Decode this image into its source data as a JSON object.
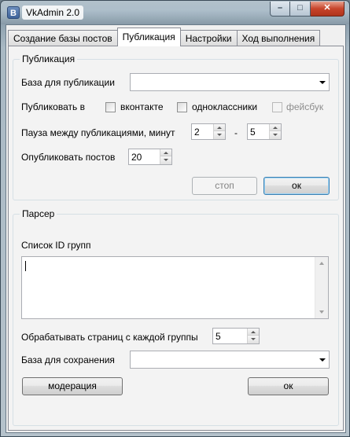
{
  "window": {
    "app_icon_letter": "B",
    "title": "VkAdmin 2.0",
    "min_glyph": "–",
    "max_glyph": "□",
    "close_glyph": "✕"
  },
  "tabs": [
    {
      "label": "Создание базы постов",
      "active": false
    },
    {
      "label": "Публикация",
      "active": true
    },
    {
      "label": "Настройки",
      "active": false
    },
    {
      "label": "Ход выполнения",
      "active": false
    }
  ],
  "publication": {
    "group_title": "Публикация",
    "base_label": "База для публикации",
    "base_value": "",
    "publish_in_label": "Публиковать в",
    "targets": [
      {
        "label": "вконтакте",
        "checked": false,
        "enabled": true
      },
      {
        "label": "одноклассники",
        "checked": false,
        "enabled": true
      },
      {
        "label": "фейсбук",
        "checked": false,
        "enabled": false
      }
    ],
    "pause_label": "Пауза между публикациями, минут",
    "pause_from": "2",
    "pause_dash": "-",
    "pause_to": "5",
    "count_label": "Опубликовать постов",
    "count_value": "20",
    "stop_label": "стоп",
    "ok_label": "ок"
  },
  "parser": {
    "group_title": "Парсер",
    "group_ids_label": "Список ID групп",
    "group_ids_value": "",
    "pages_label": "Обрабатывать страниц с каждой группы",
    "pages_value": "5",
    "save_base_label": "База для сохранения",
    "save_base_value": "",
    "moderation_label": "модерация",
    "ok_label": "ок"
  }
}
